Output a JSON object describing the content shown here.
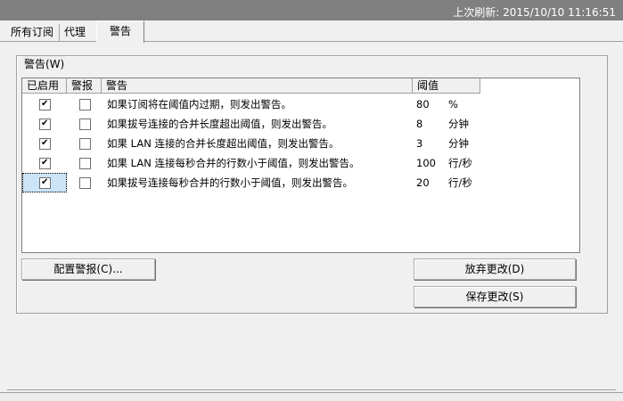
{
  "titlebar": {
    "last_refresh": "上次刷新: 2015/10/10 11:16:51"
  },
  "tabs": [
    {
      "label": "所有订阅"
    },
    {
      "label": "代理"
    },
    {
      "label": "警告"
    }
  ],
  "group": {
    "label": "警告(W)"
  },
  "list": {
    "columns": [
      "已启用",
      "警报",
      "警告",
      "阈值",
      ""
    ],
    "rows": [
      {
        "enabled": true,
        "alert": false,
        "warning": "如果订阅将在阈值内过期，则发出警告。",
        "threshold": "80",
        "unit": "%"
      },
      {
        "enabled": true,
        "alert": false,
        "warning": "如果拔号连接的合并长度超出阈值，则发出警告。",
        "threshold": "8",
        "unit": "分钟"
      },
      {
        "enabled": true,
        "alert": false,
        "warning": "如果 LAN 连接的合并长度超出阈值，则发出警告。",
        "threshold": "3",
        "unit": "分钟"
      },
      {
        "enabled": true,
        "alert": false,
        "warning": "如果 LAN 连接每秒合并的行数小于阈值，则发出警告。",
        "threshold": "100",
        "unit": "行/秒"
      },
      {
        "enabled": true,
        "alert": false,
        "warning": "如果拔号连接每秒合并的行数小于阈值，则发出警告。",
        "threshold": "20",
        "unit": "行/秒",
        "selected": true
      }
    ]
  },
  "buttons": {
    "configure": "配置警报(C)...",
    "discard": "放弃更改(D)",
    "save": "保存更改(S)"
  }
}
